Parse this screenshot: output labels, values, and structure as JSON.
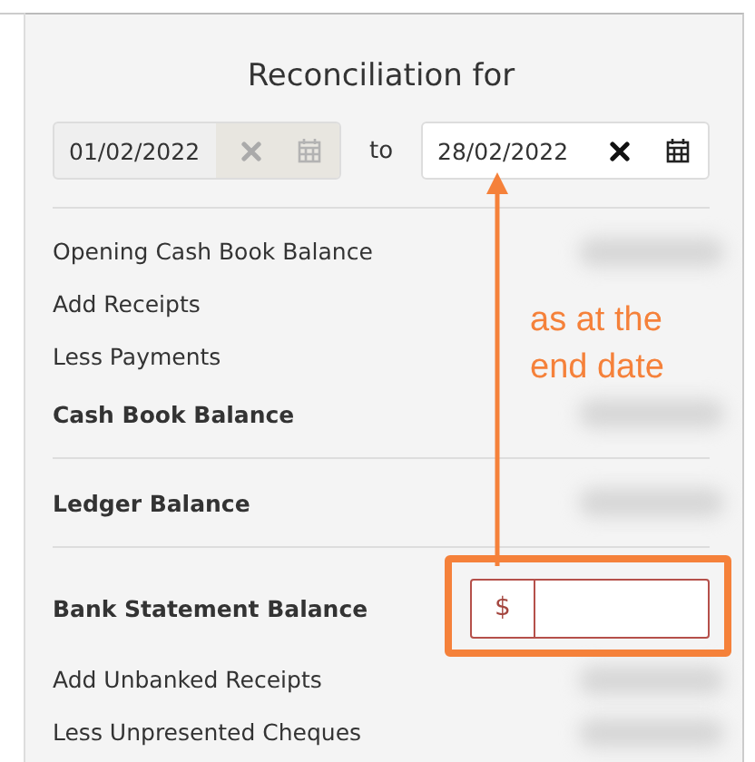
{
  "title": "Reconciliation for",
  "date_range": {
    "from": {
      "value": "01/02/2022",
      "disabled": true
    },
    "separator": "to",
    "to": {
      "value": "28/02/2022",
      "disabled": false
    }
  },
  "sections": [
    {
      "rows": [
        {
          "label": "Opening Cash Book Balance",
          "kind": "item",
          "redacted": true
        },
        {
          "label": "Add Receipts",
          "kind": "item",
          "redacted": false
        },
        {
          "label": "Less Payments",
          "kind": "item",
          "redacted": false
        },
        {
          "label": "Cash Book Balance",
          "kind": "total",
          "redacted": true
        }
      ]
    },
    {
      "rows": [
        {
          "label": "Ledger Balance",
          "kind": "total",
          "redacted": true
        }
      ]
    },
    {
      "rows": [
        {
          "label": "Bank Statement Balance",
          "kind": "input",
          "addon": "$"
        },
        {
          "label": "Add Unbanked Receipts",
          "kind": "item",
          "redacted": true
        },
        {
          "label": "Less Unpresented Cheques",
          "kind": "item",
          "redacted": true
        }
      ]
    }
  ],
  "annotation": {
    "text": "as at the end date"
  }
}
